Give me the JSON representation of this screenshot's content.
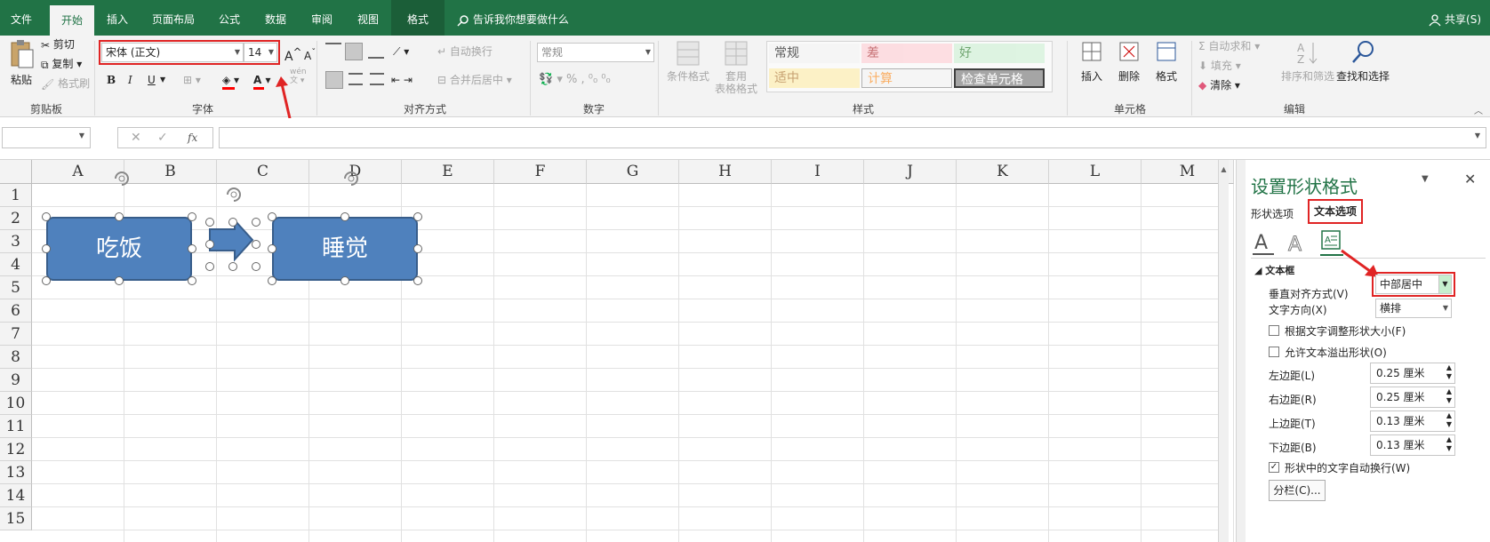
{
  "tabs": {
    "file": "文件",
    "home": "开始",
    "insert": "插入",
    "layout": "页面布局",
    "formulas": "公式",
    "data": "数据",
    "review": "审阅",
    "view": "视图",
    "format": "格式",
    "tellme": "告诉我你想要做什么",
    "share": "共享(S)"
  },
  "clipboard": {
    "paste": "粘贴",
    "cut": "剪切",
    "copy": "复制",
    "painter": "格式刷",
    "label": "剪贴板"
  },
  "font": {
    "name": "宋体 (正文)",
    "size": "14",
    "bold": "B",
    "italic": "I",
    "underline": "U",
    "label": "字体",
    "phonetic": "wén"
  },
  "align": {
    "wrap": "自动换行",
    "merge": "合并后居中",
    "label": "对齐方式"
  },
  "number": {
    "format": "常规",
    "label": "数字"
  },
  "styles": {
    "conditional": "条件格式",
    "table_line1": "套用",
    "table_line2": "表格格式",
    "cells": [
      "常规",
      "差",
      "好",
      "适中",
      "计算",
      "检查单元格"
    ],
    "label": "样式"
  },
  "cells_group": {
    "insert": "插入",
    "delete": "删除",
    "format": "格式",
    "label": "单元格"
  },
  "editing": {
    "autosum": "自动求和",
    "fill": "填充",
    "clear": "清除",
    "sort": "排序和筛选",
    "find": "查找和选择",
    "label": "编辑"
  },
  "formula_bar": {
    "namebox": "",
    "fx": "fx"
  },
  "columns": [
    "A",
    "B",
    "C",
    "D",
    "E",
    "F",
    "G",
    "H",
    "I",
    "J",
    "K",
    "L",
    "M"
  ],
  "rows": [
    "1",
    "2",
    "3",
    "4",
    "5",
    "6",
    "7",
    "8",
    "9",
    "10",
    "11",
    "12",
    "13",
    "14",
    "15"
  ],
  "shapes": {
    "left": "吃饭",
    "right": "睡觉"
  },
  "pane": {
    "title": "设置形状格式",
    "tab_shape": "形状选项",
    "tab_text": "文本选项",
    "section": "文本框",
    "valign_label": "垂直对齐方式(V)",
    "valign_value": "中部居中",
    "direction_label": "文字方向(X)",
    "direction_value": "横排",
    "autofit_label": "根据文字调整形状大小(F)",
    "overflow_label": "允许文本溢出形状(O)",
    "left_label": "左边距(L)",
    "left_value": "0.25 厘米",
    "right_label": "右边距(R)",
    "right_value": "0.25 厘米",
    "top_label": "上边距(T)",
    "top_value": "0.13 厘米",
    "bottom_label": "下边距(B)",
    "bottom_value": "0.13 厘米",
    "wrap_label": "形状中的文字自动换行(W)",
    "columns_btn": "分栏(C)..."
  },
  "colors": {
    "excel_green": "#217346",
    "shape_fill": "#4f81bd",
    "highlight_red": "#e02424"
  }
}
